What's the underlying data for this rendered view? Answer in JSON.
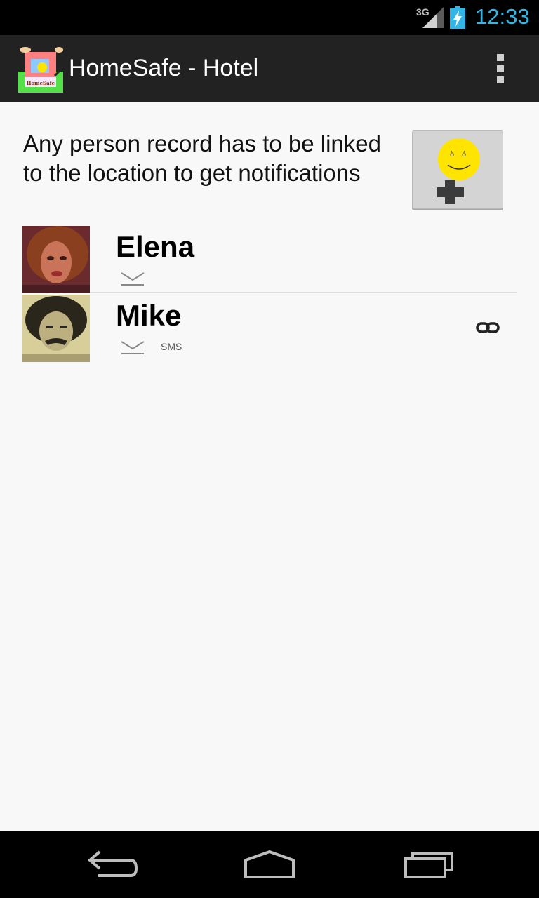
{
  "status_bar": {
    "network": "3G",
    "time": "12:33",
    "icons": [
      "signal-icon",
      "battery-charging-icon"
    ],
    "accent_color": "#33b5e5"
  },
  "action_bar": {
    "title": "HomeSafe - Hotel",
    "icon": "homesafe-logo",
    "overflow_icon": "overflow-menu-icon"
  },
  "main": {
    "info_text": "Any person record has to be linked to the location to get notifications",
    "add_button_icon": "add-person-smiley-icon",
    "persons": [
      {
        "name": "Elena",
        "email_icon": "email-icon",
        "sms": "",
        "linked": false
      },
      {
        "name": "Mike",
        "email_icon": "email-icon",
        "sms": "SMS",
        "linked": true
      }
    ]
  },
  "nav_bar": {
    "icons": [
      "back-icon",
      "home-icon",
      "recents-icon"
    ]
  }
}
